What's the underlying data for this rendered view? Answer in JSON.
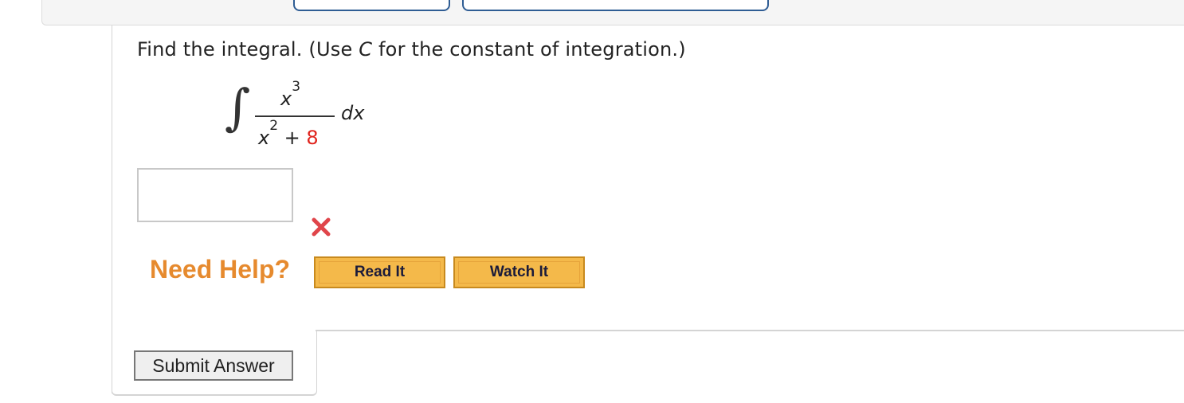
{
  "question": {
    "text_before": "Find the integral. (Use ",
    "var_c": "C",
    "text_after": " for the constant of integration.)"
  },
  "expression": {
    "integral_symbol": "∫",
    "numerator_var": "x",
    "numerator_exp": "3",
    "denominator_var": "x",
    "denominator_exp": "2",
    "denominator_op": " + ",
    "denominator_const": "8",
    "differential": "dx"
  },
  "answer": {
    "value": "",
    "status": "incorrect"
  },
  "help": {
    "label": "Need Help?",
    "read_it": "Read It",
    "watch_it": "Watch It"
  },
  "submit": {
    "label": "Submit Answer"
  },
  "colors": {
    "accent_orange": "#e68a2e",
    "help_button": "#f4b94a",
    "error_red": "#e0231c",
    "tab_blue": "#2f5d94"
  }
}
